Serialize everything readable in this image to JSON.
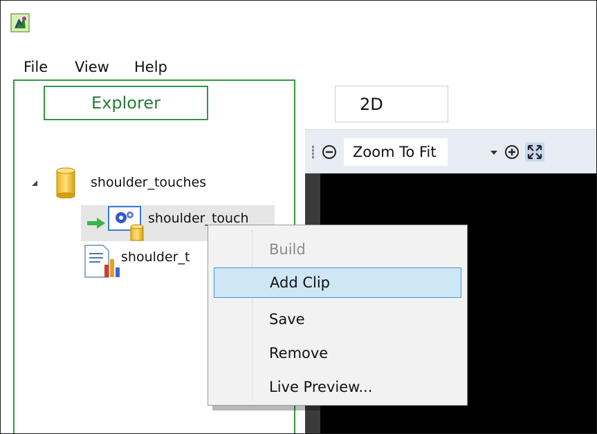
{
  "menubar": {
    "items": [
      "File",
      "View",
      "Help"
    ]
  },
  "explorer": {
    "tab_label": "Explorer",
    "tree": {
      "root_label": "shoulder_touches",
      "child1_label": "shoulder_touch",
      "child2_label": "shoulder_t"
    }
  },
  "viewer": {
    "tab_label": "2D",
    "zoom_value": "Zoom To Fit"
  },
  "context_menu": {
    "items": [
      "Build",
      "Add Clip",
      "Save",
      "Remove",
      "Live Preview..."
    ],
    "disabled_item": "Build",
    "highlighted_item": "Add Clip"
  },
  "colors": {
    "accent_green": "#2f9a3f",
    "toolbar_bg": "#e8edf4",
    "menu_highlight": "#cfe6f4",
    "menu_highlight_border": "#3f9ad1"
  },
  "icons": [
    "app-icon",
    "database-icon",
    "gear-clip-icon",
    "green-arrow-icon",
    "document-chart-icon",
    "zoom-out-icon",
    "zoom-in-icon",
    "fit-to-view-icon",
    "expand-arrow-icon"
  ]
}
